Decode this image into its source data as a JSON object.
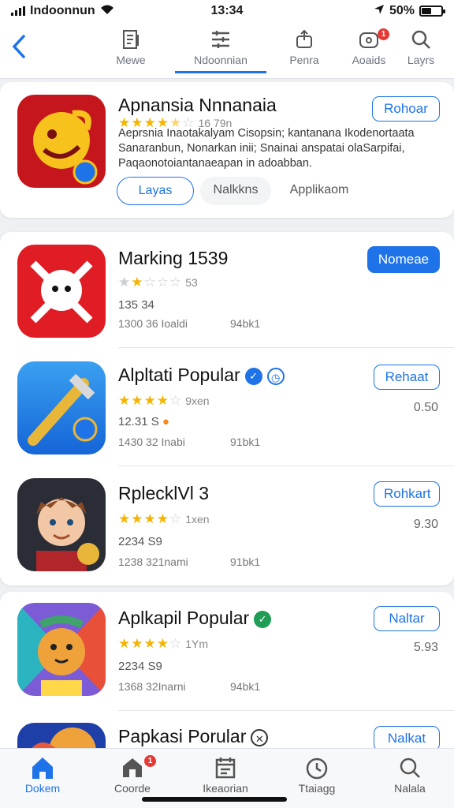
{
  "status": {
    "carrier": "Indoonnun",
    "time": "13:34",
    "battery": "50%",
    "battery_level": 0.5
  },
  "topnav": {
    "tabs": [
      {
        "label": "Mewe",
        "icon": "document-icon"
      },
      {
        "label": "Ndoonnian",
        "icon": "list-icon",
        "active": true
      },
      {
        "label": "Penra",
        "icon": "share-icon"
      },
      {
        "label": "Aoaids",
        "icon": "chat-icon",
        "badge": "1"
      },
      {
        "label": "Layrs",
        "icon": "search-icon"
      }
    ]
  },
  "featured": {
    "title": "Apnansia Nnnanaia",
    "stars": 4.5,
    "rating_text": "16 79n",
    "description": "Aeprsnia Inaotakalyam Cisopsin; kantanana Ikodenortaata Sanaranbun, Nonarkan inii; Snainai anspatai olaSarpifai, Paqaonotoiantanaeapan in adoabban.",
    "button": "Rohoar",
    "chips": [
      "Layas",
      "Nalkkns",
      "Applikaom"
    ],
    "accent": "#1e73e8"
  },
  "apps": [
    {
      "title": "Marking 1539",
      "stars": 2,
      "rating_text": "53",
      "meta": "135 34",
      "sub1": "1300 36 Ioaldi",
      "sub2": "94bk1",
      "button": "Nomeae",
      "button_style": "filled",
      "price": ""
    },
    {
      "title": "Alpltati Popular",
      "stars": 4,
      "rating_text": "9xen",
      "meta": "12.31 S",
      "sub1": "1430 32 Inabi",
      "sub2": "91bk1",
      "button": "Rehaat",
      "button_style": "outline",
      "price": "0.50"
    },
    {
      "title": "RplecklVl 3",
      "stars": 4,
      "rating_text": "1xen",
      "meta": "2234 S9",
      "sub1": "1238 321nami",
      "sub2": "91bk1",
      "button": "Rohkart",
      "button_style": "outline",
      "price": "9.30"
    },
    {
      "title": "Aplkapil Popular",
      "stars": 4,
      "rating_text": "1Ym",
      "meta": "2234 S9",
      "sub1": "1368 32Inarni",
      "sub2": "94bk1",
      "button": "Naltar",
      "button_style": "outline",
      "price": "5.93"
    },
    {
      "title": "Papkasi Porular",
      "stars": 0,
      "rating_text": "",
      "meta": "",
      "sub1": "",
      "sub2": "",
      "button": "Nalkat",
      "button_style": "outline",
      "price": ""
    }
  ],
  "bottomnav": {
    "tabs": [
      {
        "label": "Dokem",
        "icon": "home-icon",
        "active": true
      },
      {
        "label": "Coorde",
        "icon": "store-icon",
        "badge": "1"
      },
      {
        "label": "Ikeaorian",
        "icon": "calendar-icon"
      },
      {
        "label": "Ttaiagg",
        "icon": "clock-icon"
      },
      {
        "label": "Nalala",
        "icon": "search-icon"
      }
    ]
  }
}
